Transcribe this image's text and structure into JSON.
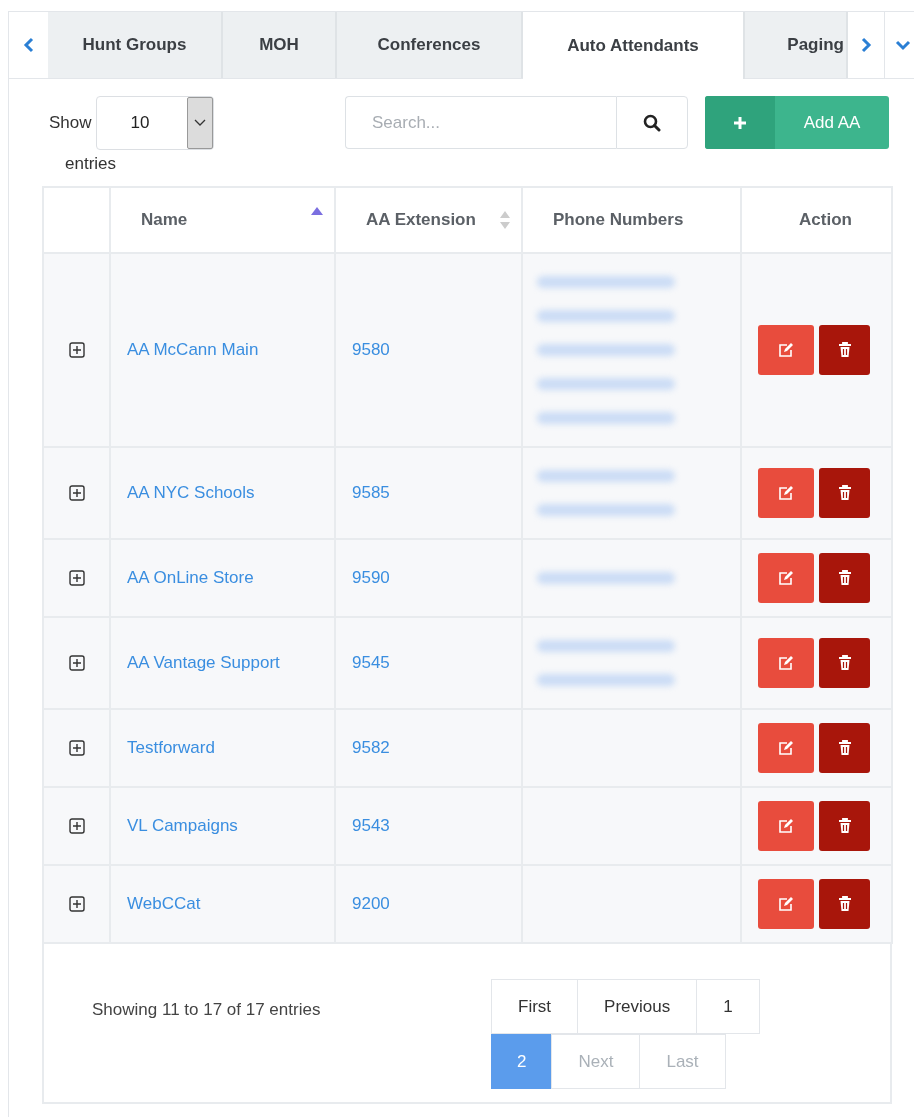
{
  "tabs": [
    {
      "label": "Hunt Groups",
      "selected": false
    },
    {
      "label": "MOH",
      "selected": false
    },
    {
      "label": "Conferences",
      "selected": false
    },
    {
      "label": "Auto Attendants",
      "selected": true
    },
    {
      "label": "Paging",
      "selected": false
    }
  ],
  "length_menu": {
    "before": "Show",
    "value": "10",
    "after": "entries"
  },
  "search": {
    "placeholder": "Search..."
  },
  "add_button": {
    "label": "Add AA"
  },
  "table": {
    "columns": [
      {
        "label": "Name",
        "sortable": true,
        "sorted_ascending": true
      },
      {
        "label": "AA Extension",
        "sortable": true,
        "sorted_ascending": false
      },
      {
        "label": "Phone Numbers",
        "sortable": false
      },
      {
        "label": "Action",
        "sortable": false
      }
    ],
    "rows": [
      {
        "name": "AA McCann Main",
        "extension": "9580",
        "phone_numbers": [
          {
            "kind": "redacted"
          },
          {
            "kind": "redacted"
          },
          {
            "kind": "redacted"
          },
          {
            "kind": "redacted"
          },
          {
            "kind": "redacted"
          }
        ]
      },
      {
        "name": "AA NYC Schools",
        "extension": "9585",
        "phone_numbers": [
          {
            "kind": "redacted"
          },
          {
            "kind": "redacted"
          }
        ]
      },
      {
        "name": "AA OnLine Store",
        "extension": "9590",
        "phone_numbers": [
          {
            "kind": "redacted"
          }
        ]
      },
      {
        "name": "AA Vantage Support",
        "extension": "9545",
        "phone_numbers": [
          {
            "kind": "redacted"
          },
          {
            "kind": "redacted"
          }
        ]
      },
      {
        "name": "Testforward",
        "extension": "9582",
        "phone_numbers": []
      },
      {
        "name": "VL Campaigns",
        "extension": "9543",
        "phone_numbers": []
      },
      {
        "name": "WebCCat",
        "extension": "9200",
        "phone_numbers": []
      }
    ]
  },
  "info": "Showing 11 to 17 of 17 entries",
  "pagination": [
    {
      "label": "First",
      "selected": false,
      "disabled": false
    },
    {
      "label": "Previous",
      "selected": false,
      "disabled": false
    },
    {
      "label": "1",
      "selected": false,
      "disabled": false
    },
    {
      "label": "2",
      "selected": true,
      "disabled": false
    },
    {
      "label": "Next",
      "selected": false,
      "disabled": true
    },
    {
      "label": "Last",
      "selected": false,
      "disabled": true
    }
  ]
}
